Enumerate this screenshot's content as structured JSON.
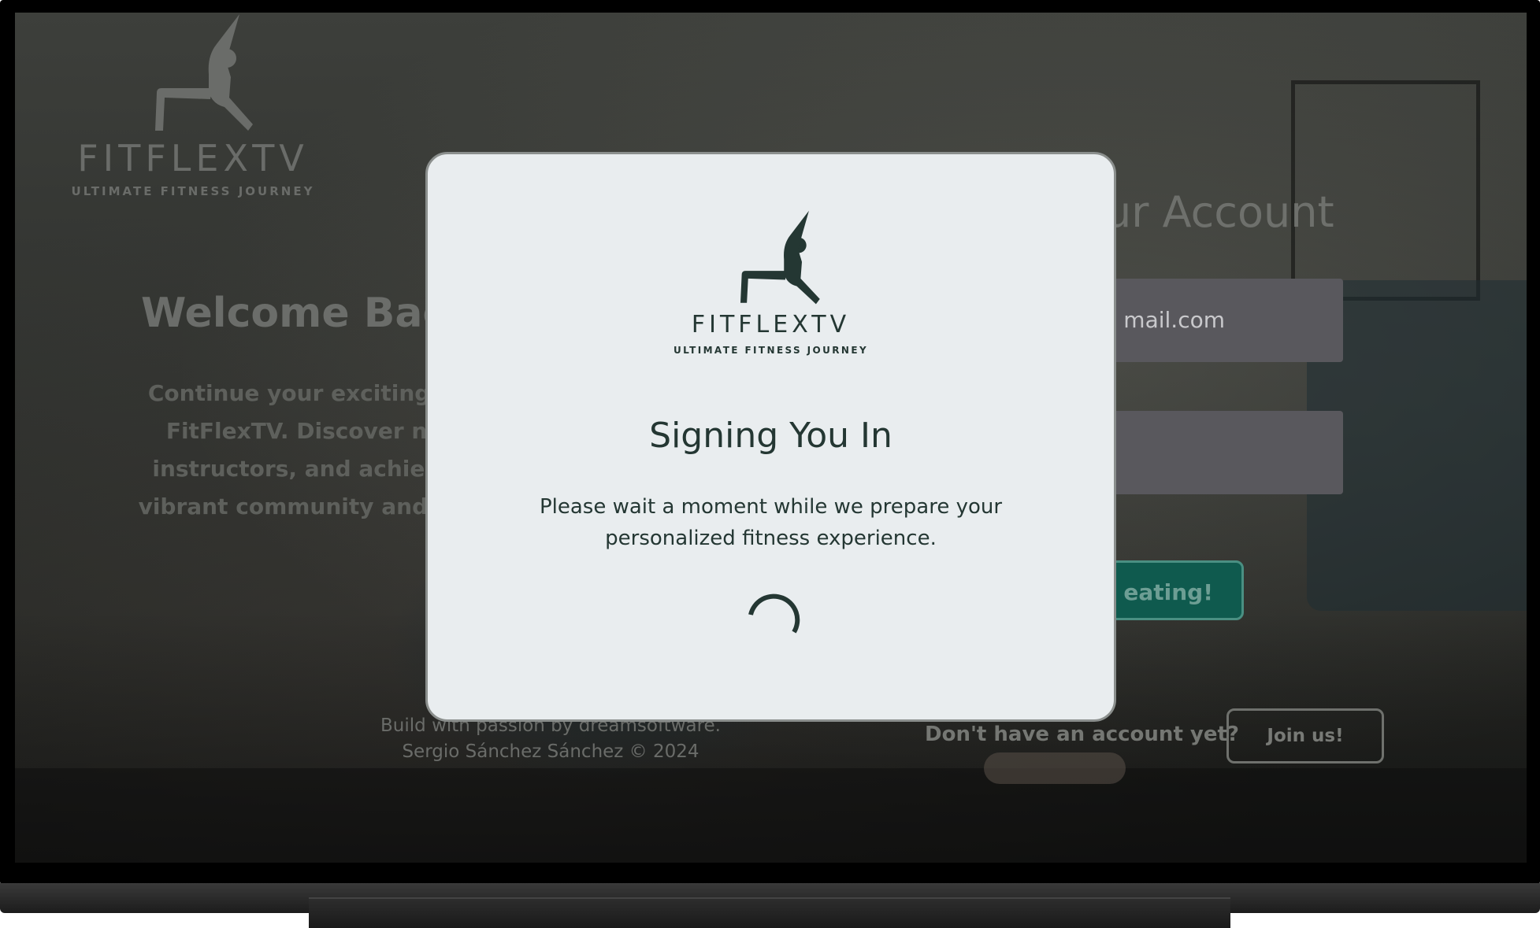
{
  "app": {
    "brand_name": "FITFLEXTV",
    "tagline": "ULTIMATE FITNESS JOURNEY"
  },
  "welcome": {
    "title": "Welcome Bac",
    "lines": [
      "Continue your exciting fitn",
      "FitFlexTV. Discover new",
      "instructors, and achieve y",
      "vibrant community and pers"
    ]
  },
  "login_form": {
    "title": "our Account",
    "email_value": "mail.com",
    "password_value": "",
    "submit_label": "eating!"
  },
  "footer": {
    "credit_line1": "Build with passion by dreamsoftware.",
    "credit_line2": "Sergio Sánchez Sánchez © 2024",
    "no_account_text": "Don't have an account yet?",
    "join_label": "Join us!"
  },
  "modal": {
    "title": "Signing You In",
    "message_line1": "Please wait a moment while we prepare your",
    "message_line2": "personalized fitness experience.",
    "spinner_icon": "loading-spinner-icon"
  },
  "colors": {
    "modal_bg": "#e9edef",
    "brand_dark": "#243733",
    "accent_green": "#0f5a4e"
  }
}
